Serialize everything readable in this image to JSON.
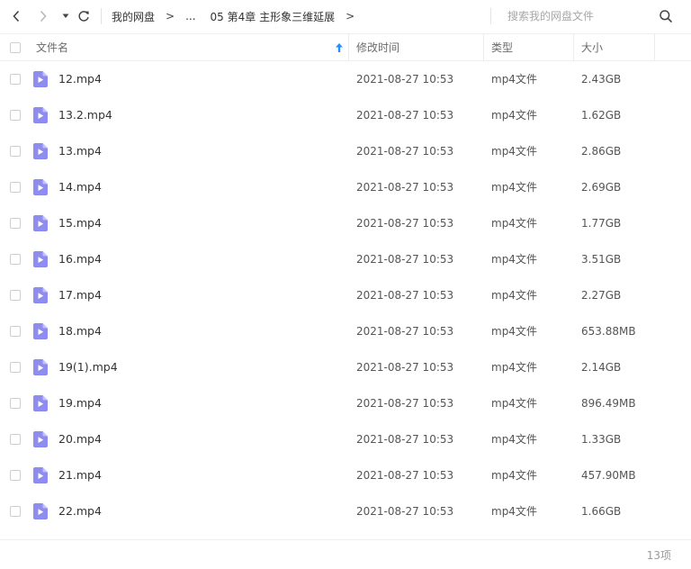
{
  "nav": {
    "back_icon": "chevron-left-icon",
    "forward_icon": "chevron-right-icon",
    "history_icon": "caret-down-icon",
    "refresh_icon": "refresh-icon"
  },
  "breadcrumb": {
    "root": "我的网盘",
    "sep1": ">",
    "ellipsis": "...",
    "current": "05 第4章 主形象三维延展",
    "sep2": ">"
  },
  "search": {
    "placeholder": "搜索我的网盘文件",
    "value": ""
  },
  "columns": {
    "name": "文件名",
    "modified": "修改时间",
    "type": "类型",
    "size": "大小"
  },
  "sort": {
    "column": "name",
    "direction": "ascending",
    "icon": "arrow-up-icon",
    "color": "#1e90ff"
  },
  "colors": {
    "file_icon": "#8f8cf0",
    "accent": "#1e90ff"
  },
  "files": [
    {
      "name": "12.mp4",
      "modified": "2021-08-27 10:53",
      "type": "mp4文件",
      "size": "2.43GB"
    },
    {
      "name": "13.2.mp4",
      "modified": "2021-08-27 10:53",
      "type": "mp4文件",
      "size": "1.62GB"
    },
    {
      "name": "13.mp4",
      "modified": "2021-08-27 10:53",
      "type": "mp4文件",
      "size": "2.86GB"
    },
    {
      "name": "14.mp4",
      "modified": "2021-08-27 10:53",
      "type": "mp4文件",
      "size": "2.69GB"
    },
    {
      "name": "15.mp4",
      "modified": "2021-08-27 10:53",
      "type": "mp4文件",
      "size": "1.77GB"
    },
    {
      "name": "16.mp4",
      "modified": "2021-08-27 10:53",
      "type": "mp4文件",
      "size": "3.51GB"
    },
    {
      "name": "17.mp4",
      "modified": "2021-08-27 10:53",
      "type": "mp4文件",
      "size": "2.27GB"
    },
    {
      "name": "18.mp4",
      "modified": "2021-08-27 10:53",
      "type": "mp4文件",
      "size": "653.88MB"
    },
    {
      "name": "19(1).mp4",
      "modified": "2021-08-27 10:53",
      "type": "mp4文件",
      "size": "2.14GB"
    },
    {
      "name": "19.mp4",
      "modified": "2021-08-27 10:53",
      "type": "mp4文件",
      "size": "896.49MB"
    },
    {
      "name": "20.mp4",
      "modified": "2021-08-27 10:53",
      "type": "mp4文件",
      "size": "1.33GB"
    },
    {
      "name": "21.mp4",
      "modified": "2021-08-27 10:53",
      "type": "mp4文件",
      "size": "457.90MB"
    },
    {
      "name": "22.mp4",
      "modified": "2021-08-27 10:53",
      "type": "mp4文件",
      "size": "1.66GB"
    }
  ],
  "footer": {
    "count": "13项"
  }
}
